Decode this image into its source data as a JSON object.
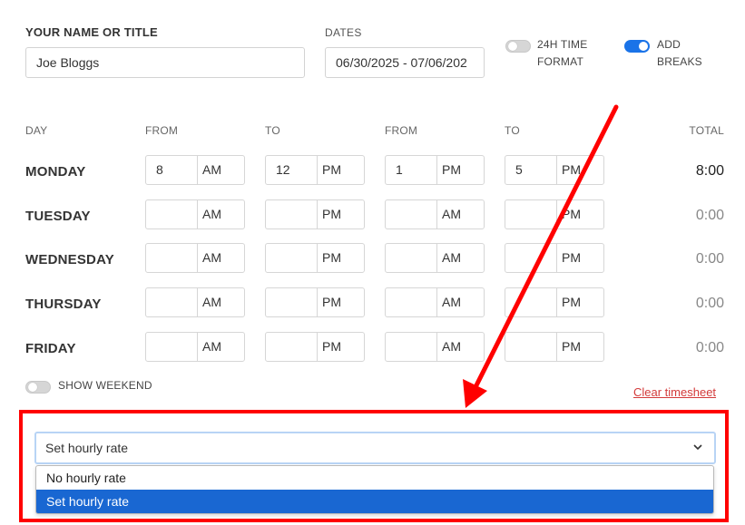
{
  "header": {
    "name_label": "YOUR NAME OR TITLE",
    "name_value": "Joe Bloggs",
    "dates_label": "DATES",
    "dates_value": "06/30/2025 - 07/06/202",
    "toggle_24h_line1": "24H TIME",
    "toggle_24h_line2": "FORMAT",
    "toggle_24h_on": false,
    "toggle_breaks_line1": "ADD",
    "toggle_breaks_line2": "BREAKS",
    "toggle_breaks_on": true
  },
  "columns": {
    "day": "DAY",
    "from1": "FROM",
    "to1": "TO",
    "from2": "FROM",
    "to2": "TO",
    "total": "TOTAL"
  },
  "rows": [
    {
      "day": "MONDAY",
      "from1": "8",
      "from1_ampm": "AM",
      "to1": "12",
      "to1_ampm": "PM",
      "from2": "1",
      "from2_ampm": "PM",
      "to2": "5",
      "to2_ampm": "PM",
      "total": "8:00"
    },
    {
      "day": "TUESDAY",
      "from1": "",
      "from1_ampm": "AM",
      "to1": "",
      "to1_ampm": "PM",
      "from2": "",
      "from2_ampm": "AM",
      "to2": "",
      "to2_ampm": "PM",
      "total": "0:00"
    },
    {
      "day": "WEDNESDAY",
      "from1": "",
      "from1_ampm": "AM",
      "to1": "",
      "to1_ampm": "PM",
      "from2": "",
      "from2_ampm": "AM",
      "to2": "",
      "to2_ampm": "PM",
      "total": "0:00"
    },
    {
      "day": "THURSDAY",
      "from1": "",
      "from1_ampm": "AM",
      "to1": "",
      "to1_ampm": "PM",
      "from2": "",
      "from2_ampm": "AM",
      "to2": "",
      "to2_ampm": "PM",
      "total": "0:00"
    },
    {
      "day": "FRIDAY",
      "from1": "",
      "from1_ampm": "AM",
      "to1": "",
      "to1_ampm": "PM",
      "from2": "",
      "from2_ampm": "AM",
      "to2": "",
      "to2_ampm": "PM",
      "total": "0:00"
    }
  ],
  "show_weekend_label": "SHOW WEEKEND",
  "show_weekend_on": false,
  "clear_label": "Clear timesheet",
  "rate_select": {
    "selected": "Set hourly rate",
    "options": [
      "No hourly rate",
      "Set hourly rate"
    ],
    "selected_index": 1
  },
  "colors": {
    "accent": "#1a73e8",
    "highlight": "#ff0000",
    "clear_link": "#d33a3a",
    "option_selected": "#1967d2"
  },
  "icons": {
    "select_chevron": "chevron-down-icon",
    "annotation": "red-arrow-icon"
  }
}
